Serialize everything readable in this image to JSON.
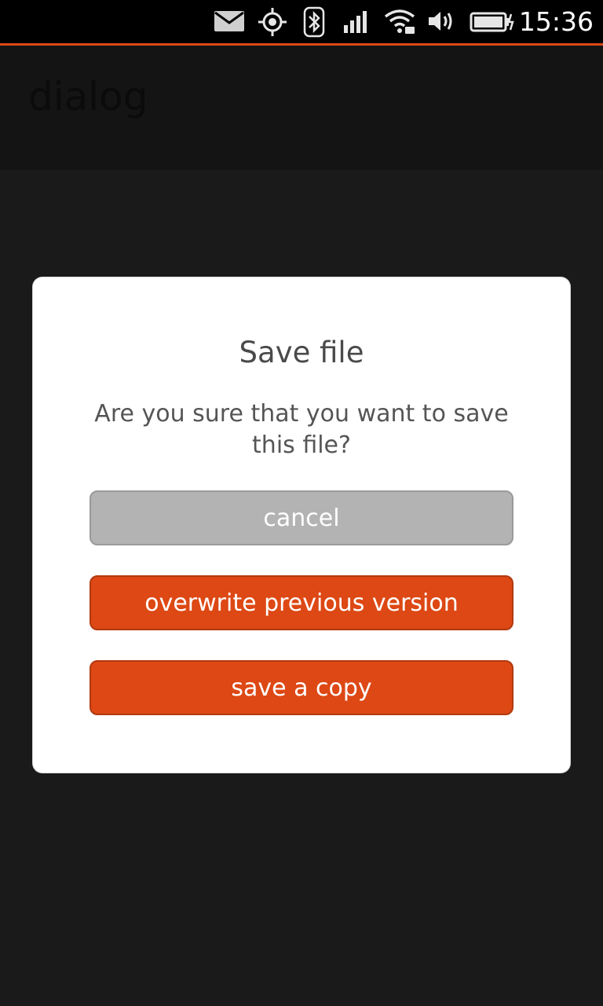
{
  "status_bar": {
    "time": "15:36",
    "icons": [
      "mail-icon",
      "location-icon",
      "bluetooth-icon",
      "signal-icon",
      "wifi-icon",
      "volume-icon",
      "battery-icon"
    ],
    "accent_color": "#dd4814"
  },
  "header": {
    "title": "dialog"
  },
  "dialog": {
    "title": "Save file",
    "text": "Are you sure that you want to save this file?",
    "buttons": {
      "cancel": "cancel",
      "overwrite": "overwrite previous version",
      "copy": "save a copy"
    }
  },
  "colors": {
    "accent": "#dd4814",
    "cancel_bg": "#b3b3b3",
    "dialog_bg": "#ffffff",
    "background": "#1a1a1a"
  }
}
